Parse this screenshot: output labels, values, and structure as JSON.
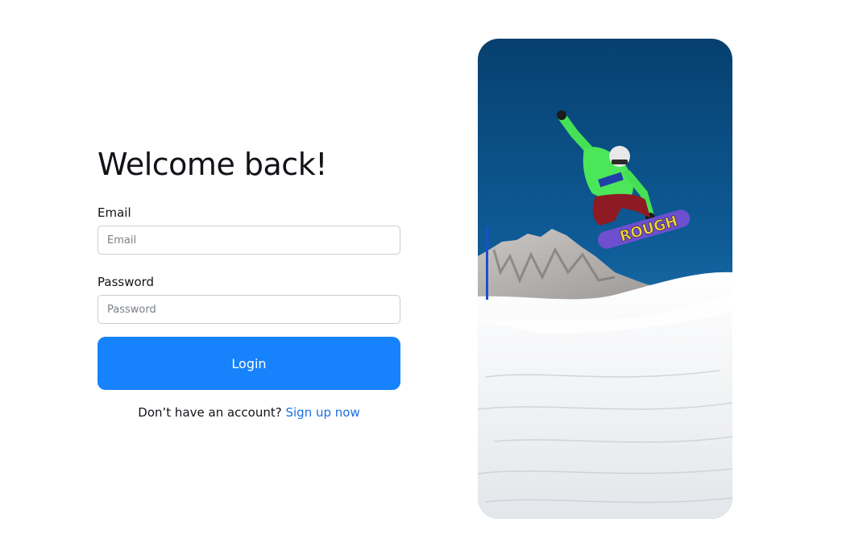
{
  "form": {
    "title": "Welcome back!",
    "email": {
      "label": "Email",
      "placeholder": "Email",
      "value": ""
    },
    "password": {
      "label": "Password",
      "placeholder": "Password",
      "value": ""
    },
    "login_label": "Login",
    "signup_prompt": "Don’t have an account?",
    "signup_link": "Sign up now"
  },
  "hero": {
    "board_text": "ROUGH"
  },
  "colors": {
    "primary": "#1682fb",
    "link": "#1a6fe0",
    "sky": "#0f5d99",
    "snow": "#f2f4f7",
    "jacket": "#4ce65a"
  }
}
